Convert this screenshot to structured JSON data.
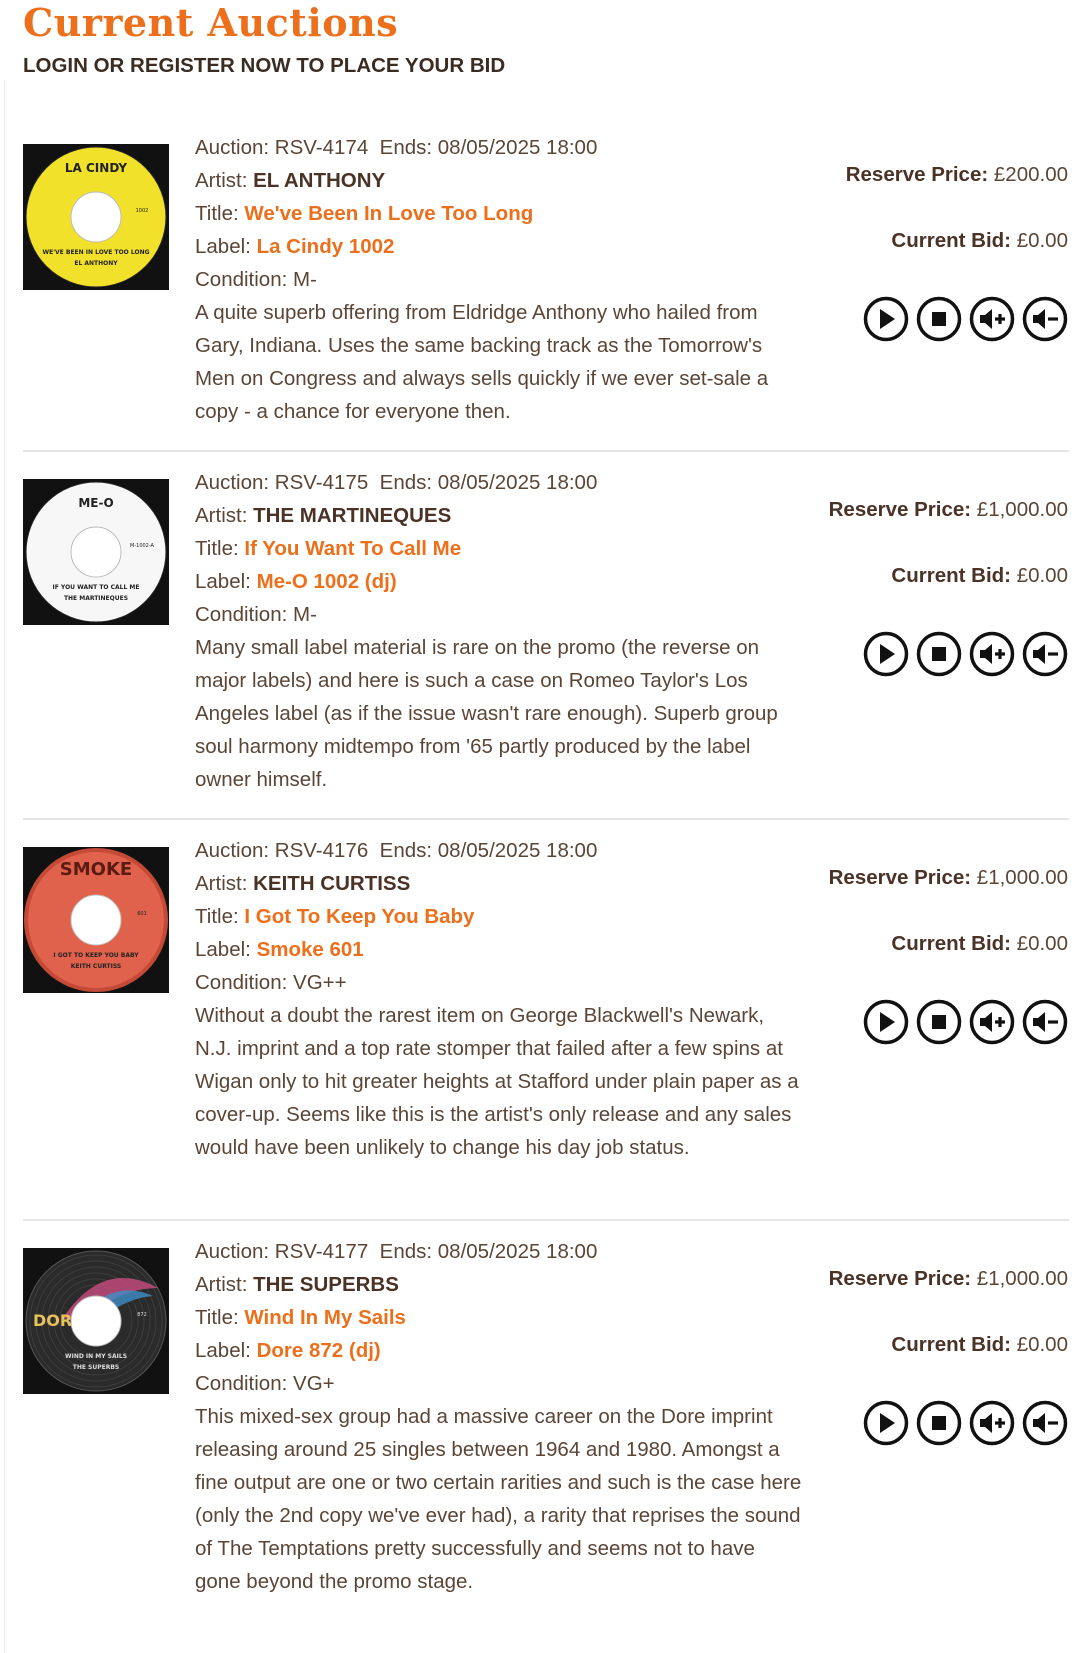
{
  "header": {
    "title": "Current Auctions",
    "subtitle": "LOGIN OR REGISTER NOW TO PLACE YOUR BID"
  },
  "labels": {
    "auction": "Auction:",
    "ends": "Ends:",
    "artist": "Artist:",
    "title": "Title:",
    "label": "Label:",
    "condition": "Condition:",
    "reserve": "Reserve Price:",
    "current_bid": "Current Bid:"
  },
  "controls": [
    "play-icon",
    "stop-icon",
    "volume-up-icon",
    "volume-down-icon"
  ],
  "colors": {
    "accent": "#ec6f1c",
    "text": "#5a4536",
    "dark": "#3b2c22"
  },
  "auctions": [
    {
      "id": "RSV-4174",
      "ends": "08/05/2025 18:00",
      "artist": "EL ANTHONY",
      "title": "We've Been In Love Too Long",
      "label": "La Cindy 1002",
      "condition": "M-",
      "reserve": "£200.00",
      "bid": "£0.00",
      "desc": "A quite superb offering from Eldridge Anthony who hailed from Gary, Indiana. Uses the same backing track as the Tomorrow's Men on Congress and always sells quickly if we ever set-sale a copy - a chance for everyone then.",
      "cover": {
        "label_text": "LA CINDY",
        "song_text": "WE'VE BEEN IN LOVE TOO LONG",
        "artist_text": "EL ANTHONY",
        "number": "1002",
        "color": "#f2e12a"
      }
    },
    {
      "id": "RSV-4175",
      "ends": "08/05/2025 18:00",
      "artist": "THE MARTINEQUES",
      "title": "If You Want To Call Me",
      "label": "Me-O 1002 (dj)",
      "condition": "M-",
      "reserve": "£1,000.00",
      "bid": "£0.00",
      "desc": "Many small label material is rare on the promo (the reverse on major labels) and here is such a case on Romeo Taylor's Los Angeles label (as if the issue wasn't rare enough). Superb group soul harmony midtempo from '65 partly produced by the label owner himself.",
      "cover": {
        "label_text": "ME-O",
        "song_text": "IF YOU WANT TO CALL ME",
        "artist_text": "THE MARTINEQUES",
        "number": "M-1002-A",
        "color": "#f7f7f7"
      }
    },
    {
      "id": "RSV-4176",
      "ends": "08/05/2025 18:00",
      "artist": "KEITH CURTISS",
      "title": "I Got To Keep You Baby",
      "label": "Smoke 601",
      "condition": "VG++",
      "reserve": "£1,000.00",
      "bid": "£0.00",
      "desc": "Without a doubt the rarest item on George Blackwell's Newark, N.J. imprint and a top rate stomper that failed after a few spins at Wigan only to hit greater heights at Stafford under plain paper as a cover-up. Seems like this is the artist's only release and any sales would have been unlikely to change his day job status.",
      "cover": {
        "label_text": "SMOKE",
        "song_text": "I GOT TO KEEP YOU BABY",
        "artist_text": "KEITH CURTISS",
        "number": "601",
        "color": "#e0624c"
      }
    },
    {
      "id": "RSV-4177",
      "ends": "08/05/2025 18:00",
      "artist": "THE SUPERBS",
      "title": "Wind In My Sails",
      "label": "Dore 872 (dj)",
      "condition": "VG+",
      "reserve": "£1,000.00",
      "bid": "£0.00",
      "desc": "This mixed-sex group had a massive career on the Dore imprint releasing around 25 singles between 1964 and 1980. Amongst a fine output are one or two certain rarities and such is the case here (only the 2nd copy we've ever had), a rarity that reprises the sound of The Temptations pretty successfully and seems not to have gone beyond the promo stage.",
      "cover": {
        "label_text": "DORÉ",
        "song_text": "WIND IN MY SAILS",
        "artist_text": "THE SUPERBS",
        "number": "872",
        "color": "#2b2b2b"
      }
    }
  ]
}
